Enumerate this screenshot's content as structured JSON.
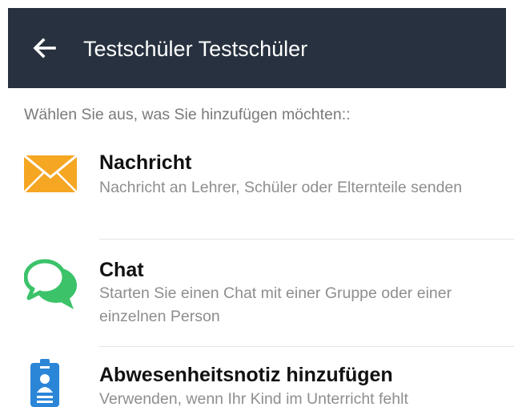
{
  "header": {
    "title": "Testschüler Testschüler",
    "back_icon": "arrow-left-icon",
    "background_color": "#27313f"
  },
  "prompt": "Wählen Sie aus, was Sie hinzufügen möchten::",
  "options": [
    {
      "icon": "envelope-icon",
      "icon_color": "#f5a623",
      "title": "Nachricht",
      "description": "Nachricht an Lehrer, Schüler oder Elternteile senden"
    },
    {
      "icon": "chat-bubbles-icon",
      "icon_color": "#3cc36a",
      "title": "Chat",
      "description": "Starten Sie einen Chat mit einer Gruppe oder einer einzelnen Person"
    },
    {
      "icon": "id-badge-icon",
      "icon_color": "#2b86d8",
      "title": "Abwesenheitsnotiz hinzufügen",
      "description": "Verwenden, wenn Ihr Kind im Unterricht fehlt"
    }
  ]
}
